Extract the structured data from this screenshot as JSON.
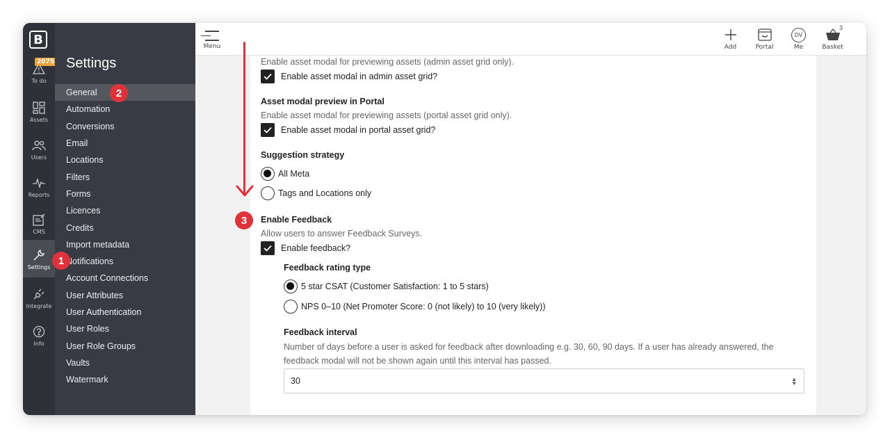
{
  "rail": {
    "todo_count": "2075",
    "items": [
      {
        "label": "To do",
        "icon": "warning-triangle-icon"
      },
      {
        "label": "Assets",
        "icon": "grid-icon"
      },
      {
        "label": "Users",
        "icon": "users-icon"
      },
      {
        "label": "Reports",
        "icon": "pulse-icon"
      },
      {
        "label": "CMS",
        "icon": "edit-document-icon"
      },
      {
        "label": "Settings",
        "icon": "wrench-icon"
      },
      {
        "label": "Integrate",
        "icon": "plug-icon"
      },
      {
        "label": "Info",
        "icon": "question-icon"
      }
    ]
  },
  "settings_nav": {
    "title": "Settings",
    "items": [
      "General",
      "Automation",
      "Conversions",
      "Email",
      "Locations",
      "Filters",
      "Forms",
      "Licences",
      "Credits",
      "Import metadata",
      "Notifications",
      "Account Connections",
      "User Attributes",
      "User Authentication",
      "User Roles",
      "User Role Groups",
      "Vaults",
      "Watermark"
    ],
    "active_index": 0
  },
  "topbar": {
    "menu_label": "Menu",
    "add_label": "Add",
    "portal_label": "Portal",
    "me_label": "Me",
    "me_initials": "DV",
    "basket_label": "Basket",
    "basket_count": "3"
  },
  "content": {
    "admin_modal_desc": "Enable asset modal for previewing assets (admin asset grid only).",
    "admin_modal_checkbox": "Enable asset modal in admin asset grid?",
    "portal_modal_title": "Asset modal preview in Portal",
    "portal_modal_desc": "Enable asset modal for previewing assets (portal asset grid only).",
    "portal_modal_checkbox": "Enable asset modal in portal asset grid?",
    "suggestion_title": "Suggestion strategy",
    "suggestion_options": [
      "All Meta",
      "Tags and Locations only"
    ],
    "feedback_title": "Enable Feedback",
    "feedback_desc": "Allow users to answer Feedback Surveys.",
    "feedback_checkbox": "Enable feedback?",
    "rating_title": "Feedback rating type",
    "rating_options": [
      "5 star CSAT (Customer Satisfaction: 1 to 5 stars)",
      "NPS 0–10 (Net Promoter Score: 0 (not likely) to 10 (very likely))"
    ],
    "interval_title": "Feedback interval",
    "interval_desc_line1": "Number of days before a user is asked for feedback after downloading e.g. 30, 60, 90 days. If a user has already answered, the",
    "interval_desc_line2": "feedback modal will not be shown again until this interval has passed.",
    "interval_value": "30"
  },
  "callouts": [
    "1",
    "2",
    "3"
  ],
  "colors": {
    "callout": "#e0323b",
    "sidebar": "#393b44",
    "rail": "#2f3139",
    "todo_badge": "#e8a33d"
  }
}
